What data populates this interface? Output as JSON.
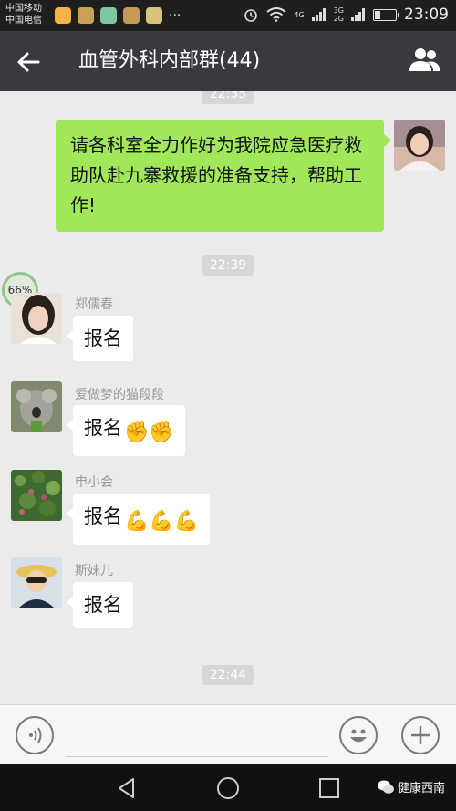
{
  "status_bar": {
    "carrier1": "中国移动",
    "carrier2": "中国电信",
    "net1": "4G",
    "net2a": "3G",
    "net2b": "2G",
    "time": "23:09",
    "overflow_icon": "more-dots-icon"
  },
  "header": {
    "title": "血管外科内部群(44)",
    "back_icon": "arrow-left-icon",
    "members_icon": "people-icon"
  },
  "chat": {
    "top_time": "22:35",
    "my_message": "请各科室全力作好为我院应急医疗救助队赴九寨救援的准备支持，帮助工作!",
    "time1": "22:39",
    "progress_badge": "66%",
    "messages": [
      {
        "name": "郑儒春",
        "text": "报名",
        "emoji": ""
      },
      {
        "name": "爱做梦的猫段段",
        "text": "报名",
        "emoji": "✊✊"
      },
      {
        "name": "申小会",
        "text": "报名",
        "emoji": "💪💪💪"
      },
      {
        "name": "斯妹儿",
        "text": "报名",
        "emoji": ""
      }
    ],
    "time2": "22:44"
  },
  "input_bar": {
    "voice_icon": "voice-icon",
    "emoji_icon": "smiley-icon",
    "plus_icon": "plus-icon"
  },
  "nav": {
    "watermark": "健康西南"
  },
  "colors": {
    "header_bg": "#393a3f",
    "my_bubble": "#a0e75a",
    "chat_bg": "#ebebeb"
  }
}
